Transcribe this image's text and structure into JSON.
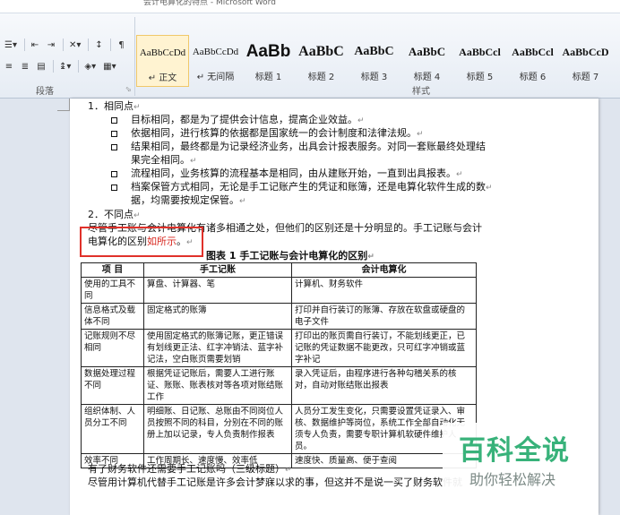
{
  "window": {
    "title": "会计电算化的特点 - Microsoft Word"
  },
  "ribbon": {
    "paragraph_group_label": "段落",
    "styles_group_label": "样式",
    "styles": [
      {
        "sample": "AaBbCcDd",
        "name": "正文"
      },
      {
        "sample": "AaBbCcDd",
        "name": "无间隔"
      },
      {
        "sample": "AaBb",
        "name": "标题 1"
      },
      {
        "sample": "AaBbC",
        "name": "标题 2"
      },
      {
        "sample": "AaBbC",
        "name": "标题 3"
      },
      {
        "sample": "AaBbC",
        "name": "标题 4"
      },
      {
        "sample": "AaBbCcl",
        "name": "标题 5"
      },
      {
        "sample": "AaBbCcl",
        "name": "标题 6"
      },
      {
        "sample": "AaBbCcD",
        "name": "标题 7"
      }
    ]
  },
  "document": {
    "h1": "1．相同点",
    "same_items": [
      {
        "l1": "目标相同，都是为了提供会计信息，提高企业效益。",
        "l2": ""
      },
      {
        "l1": "依据相同，进行核算的依据都是国家统一的会计制度和法律法规。",
        "l2": ""
      },
      {
        "l1": "结果相同，最终都是为记录经济业务，出具会计报表服务。对同一套账最终处理结",
        "l2": "果完全相同。"
      },
      {
        "l1": "流程相同，业务核算的流程基本是相同，由从建账开始，一直到出具报表。",
        "l2": ""
      },
      {
        "l1": "档案保管方式相同，无论是手工记账产生的凭证和账簿，还是电算化软件生成的数",
        "l2": "据，均需要按规定保管。"
      }
    ],
    "h2": "2．不同点",
    "para1": "尽管手工账与会计电算化有诸多相通之处，但他们的区别还是十分明显的。手工记账与会计",
    "para2_a": "电算化的区别",
    "para2_b": "如所示",
    "para2_c": "。",
    "table_caption": "图表 1 手工记账与会计电算化的区别",
    "table": {
      "headers": [
        "项  目",
        "手工记账",
        "会计电算化"
      ],
      "rows": [
        [
          "使用的工具不同",
          "算盘、计算器、笔",
          "计算机、财务软件"
        ],
        [
          "信息格式及载体不同",
          "固定格式的账簿",
          "打印并自行装订的账簿、存放在软盘或硬盘的电子文件"
        ],
        [
          "记账规则不尽相同",
          "使用固定格式的账簿记账，更正错误有划线更正法、红字冲销法、蓝字补记法，空白账页需要划销",
          "打印出的账页需自行装订，不能划线更正，已记账的凭证数据不能更改，只可红字冲销或蓝字补记"
        ],
        [
          "数据处理过程不同",
          "根据凭证记账后，需要人工进行账证、账账、账表核对等各项对账结账工作",
          "录入凭证后，由程序进行各种勾稽关系的核对，自动对账结账出报表"
        ],
        [
          "组织体制、人员分工不同",
          "明细账、日记账、总账由不同岗位人员按照不同的科目，分别在不同的账册上加以记录，专人负责制作报表",
          "人员分工发生变化，只需要设置凭证录入、审核、数据维护等岗位，系统工作全部自动化无须专人负责，需要专职计算机软硬件维护人员。"
        ],
        [
          "效率不同",
          "工作周期长、速度慢、效率低",
          "速度快、质量高、便于查阅"
        ]
      ]
    },
    "after1": "有了财务软件还需要手工记账吗（三级标题）",
    "after2": "尽管用计算机代替手工记账是许多会计梦寐以求的事，但这并不是说一买了财务软件就"
  },
  "watermark": {
    "big": "百科全说",
    "small": "助你轻松解决"
  }
}
